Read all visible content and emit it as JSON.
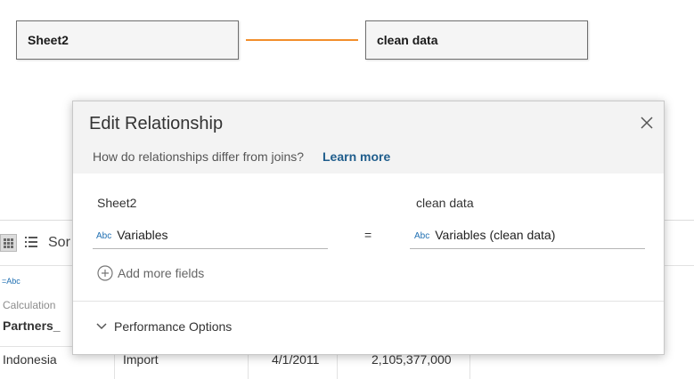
{
  "canvas": {
    "left_table": "Sheet2",
    "right_table": "clean data",
    "connector_color": "#f28e2b"
  },
  "background_grid": {
    "toolbar": {
      "sort_label": "Sor"
    },
    "column": {
      "type_icon": "=Abc",
      "type_label": "Calculation",
      "field_name": "Partners_"
    },
    "row": [
      "Indonesia",
      "Import",
      "4/1/2011",
      "2,105,377,000"
    ]
  },
  "dialog": {
    "title": "Edit Relationship",
    "subtitle": "How do relationships differ from joins?",
    "learn_more": "Learn more",
    "left": {
      "source": "Sheet2",
      "type_icon": "Abc",
      "field": "Variables"
    },
    "operator": "=",
    "right": {
      "source": "clean data",
      "type_icon": "Abc",
      "field": "Variables (clean data)"
    },
    "add_more_fields": "Add more fields",
    "performance_options": "Performance Options",
    "accent_color": "#1f5d8c"
  }
}
